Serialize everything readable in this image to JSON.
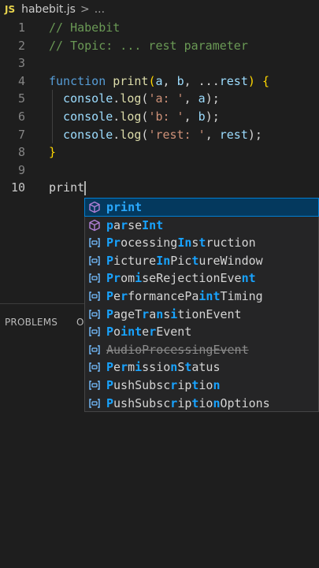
{
  "breadcrumb": {
    "lang_badge": "JS",
    "filename": "habebit.js",
    "separator": ">",
    "ellipsis": "..."
  },
  "editor": {
    "lines": [
      {
        "num": "1",
        "tokens": [
          {
            "t": "// Habebit",
            "c": "com"
          }
        ]
      },
      {
        "num": "2",
        "tokens": [
          {
            "t": "// Topic: ... rest parameter",
            "c": "com"
          }
        ]
      },
      {
        "num": "3",
        "tokens": []
      },
      {
        "num": "4",
        "tokens": [
          {
            "t": "function ",
            "c": "kw"
          },
          {
            "t": "print",
            "c": "fn"
          },
          {
            "t": "(",
            "c": "brace"
          },
          {
            "t": "a",
            "c": "var"
          },
          {
            "t": ", ",
            "c": "pun"
          },
          {
            "t": "b",
            "c": "var"
          },
          {
            "t": ", ...",
            "c": "pun"
          },
          {
            "t": "rest",
            "c": "var"
          },
          {
            "t": ")",
            "c": "brace"
          },
          {
            "t": " ",
            "c": "pun"
          },
          {
            "t": "{",
            "c": "brace"
          }
        ]
      },
      {
        "num": "5",
        "tokens": [
          {
            "t": "  console",
            "c": "var"
          },
          {
            "t": ".",
            "c": "pun"
          },
          {
            "t": "log",
            "c": "fn"
          },
          {
            "t": "(",
            "c": "pun"
          },
          {
            "t": "'a: '",
            "c": "str"
          },
          {
            "t": ", ",
            "c": "pun"
          },
          {
            "t": "a",
            "c": "var"
          },
          {
            "t": ");",
            "c": "pun"
          }
        ]
      },
      {
        "num": "6",
        "tokens": [
          {
            "t": "  console",
            "c": "var"
          },
          {
            "t": ".",
            "c": "pun"
          },
          {
            "t": "log",
            "c": "fn"
          },
          {
            "t": "(",
            "c": "pun"
          },
          {
            "t": "'b: '",
            "c": "str"
          },
          {
            "t": ", ",
            "c": "pun"
          },
          {
            "t": "b",
            "c": "var"
          },
          {
            "t": ");",
            "c": "pun"
          }
        ]
      },
      {
        "num": "7",
        "tokens": [
          {
            "t": "  console",
            "c": "var"
          },
          {
            "t": ".",
            "c": "pun"
          },
          {
            "t": "log",
            "c": "fn"
          },
          {
            "t": "(",
            "c": "pun"
          },
          {
            "t": "'rest: '",
            "c": "str"
          },
          {
            "t": ", ",
            "c": "pun"
          },
          {
            "t": "rest",
            "c": "var"
          },
          {
            "t": ");",
            "c": "pun"
          }
        ]
      },
      {
        "num": "8",
        "tokens": [
          {
            "t": "}",
            "c": "brace"
          }
        ]
      },
      {
        "num": "9",
        "tokens": []
      },
      {
        "num": "10",
        "tokens": [
          {
            "t": "print",
            "c": "pun"
          }
        ],
        "active": true,
        "cursor": true
      }
    ]
  },
  "panel": {
    "tabs": [
      "PROBLEMS",
      "O"
    ]
  },
  "suggestions": [
    {
      "kind": "function",
      "parts": [
        {
          "t": "print",
          "h": true
        }
      ],
      "selected": true
    },
    {
      "kind": "function",
      "parts": [
        {
          "t": "p",
          "h": true
        },
        {
          "t": "a"
        },
        {
          "t": "r",
          "h": true
        },
        {
          "t": "se"
        },
        {
          "t": "Int",
          "h": true
        }
      ]
    },
    {
      "kind": "variable",
      "parts": [
        {
          "t": "P",
          "h": true
        },
        {
          "t": "r",
          "h": true
        },
        {
          "t": "ocessing"
        },
        {
          "t": "In",
          "h": true
        },
        {
          "t": "s"
        },
        {
          "t": "t",
          "h": true
        },
        {
          "t": "ruction"
        }
      ]
    },
    {
      "kind": "variable",
      "parts": [
        {
          "t": "P",
          "h": true
        },
        {
          "t": "i"
        },
        {
          "t": "cture"
        },
        {
          "t": "In",
          "h": true
        },
        {
          "t": "Pic"
        },
        {
          "t": "t",
          "h": true
        },
        {
          "t": "ureWindow"
        }
      ]
    },
    {
      "kind": "variable",
      "parts": [
        {
          "t": "Pr",
          "h": true
        },
        {
          "t": "om"
        },
        {
          "t": "i",
          "h": true
        },
        {
          "t": "seRejectionEve"
        },
        {
          "t": "nt",
          "h": true
        }
      ]
    },
    {
      "kind": "variable",
      "parts": [
        {
          "t": "P",
          "h": true
        },
        {
          "t": "e"
        },
        {
          "t": "r",
          "h": true
        },
        {
          "t": "formancePa"
        },
        {
          "t": "int",
          "h": true
        },
        {
          "t": "Timing"
        }
      ]
    },
    {
      "kind": "variable",
      "parts": [
        {
          "t": "P",
          "h": true
        },
        {
          "t": "ageT"
        },
        {
          "t": "r",
          "h": true
        },
        {
          "t": "a"
        },
        {
          "t": "n",
          "h": true
        },
        {
          "t": "s"
        },
        {
          "t": "i",
          "h": true
        },
        {
          "t": "tionEvent"
        }
      ]
    },
    {
      "kind": "variable",
      "parts": [
        {
          "t": "P",
          "h": true
        },
        {
          "t": "o"
        },
        {
          "t": "int",
          "h": true
        },
        {
          "t": "e"
        },
        {
          "t": "r",
          "h": true
        },
        {
          "t": "Event"
        }
      ]
    },
    {
      "kind": "variable",
      "parts": [
        {
          "t": "AudioProcessingEvent"
        }
      ],
      "deprecated": true
    },
    {
      "kind": "variable",
      "parts": [
        {
          "t": "P",
          "h": true
        },
        {
          "t": "e"
        },
        {
          "t": "r",
          "h": true
        },
        {
          "t": "m"
        },
        {
          "t": "i",
          "h": true
        },
        {
          "t": "ssio"
        },
        {
          "t": "n",
          "h": true
        },
        {
          "t": "S"
        },
        {
          "t": "t",
          "h": true
        },
        {
          "t": "atus"
        }
      ]
    },
    {
      "kind": "variable",
      "parts": [
        {
          "t": "P",
          "h": true
        },
        {
          "t": "ushSubsc"
        },
        {
          "t": "r",
          "h": true
        },
        {
          "t": "ip"
        },
        {
          "t": "t",
          "h": true
        },
        {
          "t": "io"
        },
        {
          "t": "n",
          "h": true
        }
      ]
    },
    {
      "kind": "variable",
      "parts": [
        {
          "t": "P",
          "h": true
        },
        {
          "t": "ushSubsc"
        },
        {
          "t": "r",
          "h": true
        },
        {
          "t": "ip"
        },
        {
          "t": "t",
          "h": true
        },
        {
          "t": "io"
        },
        {
          "t": "n",
          "h": true
        },
        {
          "t": "Options"
        }
      ]
    }
  ],
  "colors": {
    "background": "#1e1e1e",
    "selection": "#04395e",
    "match_highlight": "#18a3ff"
  }
}
